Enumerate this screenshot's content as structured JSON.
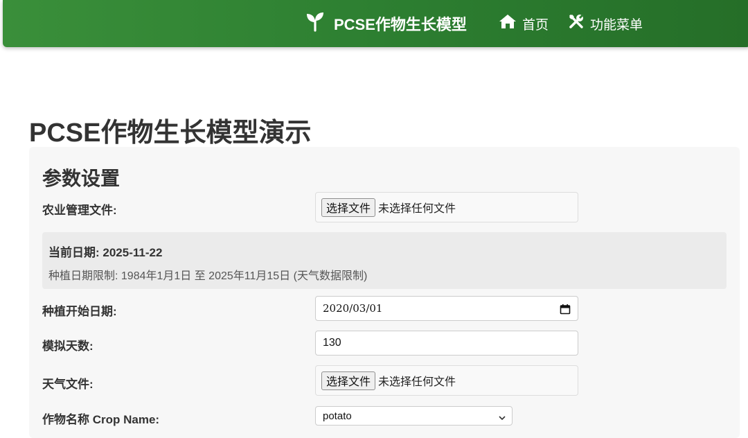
{
  "navbar": {
    "brand": "PCSE作物生长模型",
    "brand_icon": "sprout-icon",
    "home_label": "首页",
    "home_icon": "home-icon",
    "menu_label": "功能菜单",
    "menu_icon": "tools-icon",
    "color": "#2d7f31"
  },
  "page": {
    "title": "PCSE作物生长模型演示"
  },
  "settings": {
    "title": "参数设置",
    "management_file": {
      "label": "农业管理文件:",
      "button": "选择文件",
      "status": "未选择任何文件"
    },
    "info": {
      "current_date": "当前日期: 2025-11-22",
      "limit": "种植日期限制: 1984年1月1日 至 2025年11月15日 (天气数据限制)"
    },
    "start_date": {
      "label": "种植开始日期:",
      "value": "2020/03/01",
      "icon": "calendar-icon"
    },
    "sim_days": {
      "label": "模拟天数:",
      "value": "130"
    },
    "weather_file": {
      "label": "天气文件:",
      "button": "选择文件",
      "status": "未选择任何文件"
    },
    "crop_name": {
      "label": "作物名称 Crop Name:",
      "value": "potato"
    }
  }
}
